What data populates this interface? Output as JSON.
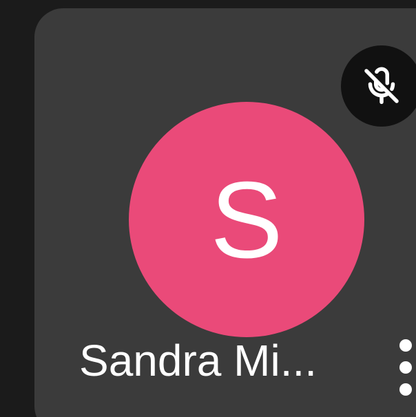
{
  "participant": {
    "avatar_initial": "S",
    "name": "Sandra Mi...",
    "avatar_color": "#ea4a79",
    "muted": true,
    "mute_icon": "mic-off-icon",
    "more_icon": "more-vertical-icon"
  },
  "colors": {
    "tile_background": "#3b3b3b",
    "page_background": "#1b1b1b",
    "badge_background": "#111111",
    "text": "#ffffff"
  }
}
